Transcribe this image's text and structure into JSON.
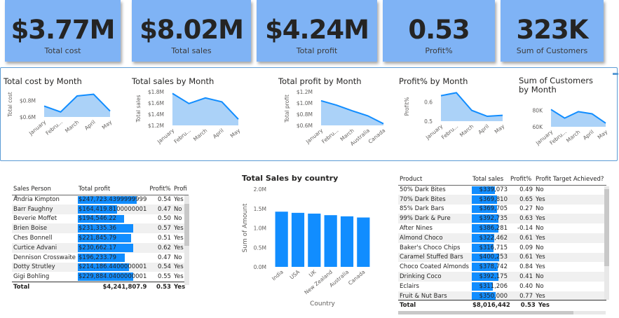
{
  "cards": [
    {
      "value": "$3.77M",
      "label": "Total cost"
    },
    {
      "value": "$8.02M",
      "label": "Total sales"
    },
    {
      "value": "$4.24M",
      "label": "Total profit"
    },
    {
      "value": "0.53",
      "label": "Profit%"
    },
    {
      "value": "323K",
      "label": "Sum of Customers"
    }
  ],
  "months": [
    "January",
    "Febru...",
    "March",
    "April",
    "May"
  ],
  "chart_data": [
    {
      "type": "area",
      "title": "Total cost by Month",
      "ylabel": "Total cost",
      "yticks": [
        "$0.8M",
        "$0.6M"
      ],
      "ylim": [
        0.6,
        0.9
      ],
      "x": [
        "January",
        "Febru...",
        "March",
        "April",
        "May"
      ],
      "values": [
        0.73,
        0.66,
        0.85,
        0.87,
        0.67
      ]
    },
    {
      "type": "area",
      "title": "Total sales by Month",
      "ylabel": "Total sales",
      "yticks": [
        "$1.8M",
        "$1.6M",
        "$1.4M",
        "$1.2M"
      ],
      "ylim": [
        1.2,
        1.8
      ],
      "x": [
        "January",
        "Febru...",
        "March",
        "April",
        "May"
      ],
      "values": [
        1.77,
        1.59,
        1.69,
        1.62,
        1.31
      ]
    },
    {
      "type": "area",
      "title": "Total profit by Month",
      "ylabel": "Total profit",
      "yticks": [
        "$1.2M",
        "$1.0M",
        "$0.8M",
        "$0.6M"
      ],
      "ylim": [
        0.6,
        1.2
      ],
      "x": [
        "January",
        "Febru...",
        "March",
        "Australia",
        "Canada"
      ],
      "values": [
        1.04,
        0.96,
        0.86,
        0.77,
        0.63
      ]
    },
    {
      "type": "area",
      "title": "Profit% by Month",
      "ylabel": "Profit%",
      "yticks": [
        "0.6",
        "0.5"
      ],
      "ylim": [
        0.45,
        0.6
      ],
      "x": [
        "January",
        "Febru...",
        "March",
        "April",
        "May"
      ],
      "values": [
        0.58,
        0.595,
        0.505,
        0.475,
        0.48
      ]
    },
    {
      "type": "area",
      "title": "Sum of Customers by Month",
      "ylabel": "",
      "yticks": [
        "80K",
        "60K"
      ],
      "ylim": [
        50,
        85
      ],
      "x": [
        "January",
        "Febru...",
        "March",
        "April",
        "May"
      ],
      "values": [
        74,
        62,
        71,
        68,
        55
      ]
    },
    {
      "type": "bar",
      "title": "Total Sales by country",
      "xlabel": "Country",
      "ylabel": "Sum of Amount",
      "yticks": [
        "2.0M",
        "1.5M",
        "1.0M",
        "0.5M",
        "0.0M"
      ],
      "ylim": [
        0,
        2.0
      ],
      "categories": [
        "India",
        "USA",
        "UK",
        "New Zealand",
        "Australia",
        "Canada"
      ],
      "values": [
        1.42,
        1.39,
        1.37,
        1.33,
        1.3,
        1.27
      ]
    }
  ],
  "sales_table": {
    "headers": [
      "Sales Person",
      "Total profit",
      "Profit%",
      "Profi"
    ],
    "rows": [
      {
        "name": "Andria Kimpton",
        "profit": "$247,723.4399999999",
        "pct": "0.54",
        "ach": "Yes",
        "bar": 0.88
      },
      {
        "name": "Barr Faughny",
        "profit": "$164,419.8100000001",
        "pct": "0.47",
        "ach": "No",
        "bar": 0.58
      },
      {
        "name": "Beverie Moffet",
        "profit": "$194,546.22",
        "pct": "0.50",
        "ach": "No",
        "bar": 0.69
      },
      {
        "name": "Brien Boise",
        "profit": "$231,335.36",
        "pct": "0.57",
        "ach": "Yes",
        "bar": 0.82
      },
      {
        "name": "Ches Bonnell",
        "profit": "$221,845.79",
        "pct": "0.51",
        "ach": "Yes",
        "bar": 0.79
      },
      {
        "name": "Curtice Advani",
        "profit": "$230,662.17",
        "pct": "0.62",
        "ach": "Yes",
        "bar": 0.82
      },
      {
        "name": "Dennison Crosswaite",
        "profit": "$196,233.79",
        "pct": "0.47",
        "ach": "No",
        "bar": 0.7
      },
      {
        "name": "Dotty Strutley",
        "profit": "$214,186.4400000001",
        "pct": "0.54",
        "ach": "Yes",
        "bar": 0.76
      },
      {
        "name": "Gigi Bohling",
        "profit": "$229,884.0400000001",
        "pct": "0.55",
        "ach": "Yes",
        "bar": 0.82
      }
    ],
    "total": {
      "label": "Total",
      "profit": "$4,241,807.9",
      "pct": "0.53",
      "ach": "Yes"
    }
  },
  "product_table": {
    "headers": [
      "Product",
      "Total sales",
      "Profit%",
      "Profit Target Achieved?"
    ],
    "rows": [
      {
        "name": "50% Dark Bites",
        "sales": "$339,073",
        "pct": "0.49",
        "ach": "No",
        "bar": 0.83
      },
      {
        "name": "70% Dark Bites",
        "sales": "$369,810",
        "pct": "0.65",
        "ach": "Yes",
        "bar": 0.9
      },
      {
        "name": "85% Dark Bars",
        "sales": "$369,705",
        "pct": "0.27",
        "ach": "No",
        "bar": 0.9
      },
      {
        "name": "99% Dark & Pure",
        "sales": "$392,735",
        "pct": "0.63",
        "ach": "Yes",
        "bar": 0.96
      },
      {
        "name": "After Nines",
        "sales": "$386,281",
        "pct": "-0.14",
        "ach": "No",
        "bar": 0.94
      },
      {
        "name": "Almond Choco",
        "sales": "$322,462",
        "pct": "0.61",
        "ach": "Yes",
        "bar": 0.79
      },
      {
        "name": "Baker's Choco Chips",
        "sales": "$316,715",
        "pct": "0.09",
        "ach": "No",
        "bar": 0.77
      },
      {
        "name": "Caramel Stuffed Bars",
        "sales": "$400,253",
        "pct": "0.61",
        "ach": "Yes",
        "bar": 0.98
      },
      {
        "name": "Choco Coated Almonds",
        "sales": "$378,742",
        "pct": "0.84",
        "ach": "Yes",
        "bar": 0.92
      },
      {
        "name": "Drinking Coco",
        "sales": "$392,175",
        "pct": "0.41",
        "ach": "No",
        "bar": 0.96
      },
      {
        "name": "Eclairs",
        "sales": "$311,206",
        "pct": "0.40",
        "ach": "No",
        "bar": 0.76
      },
      {
        "name": "Fruit & Nut Bars",
        "sales": "$350,000",
        "pct": "0.77",
        "ach": "Yes",
        "bar": 0.85
      }
    ],
    "total": {
      "label": "Total",
      "sales": "$8,016,442",
      "pct": "0.53",
      "ach": "Yes"
    }
  },
  "colors": {
    "card_bg": "#7fb3f5",
    "line": "#118dff",
    "area": "#9ccaf7",
    "bar": "#118dff",
    "frame": "#5b9bd5"
  }
}
